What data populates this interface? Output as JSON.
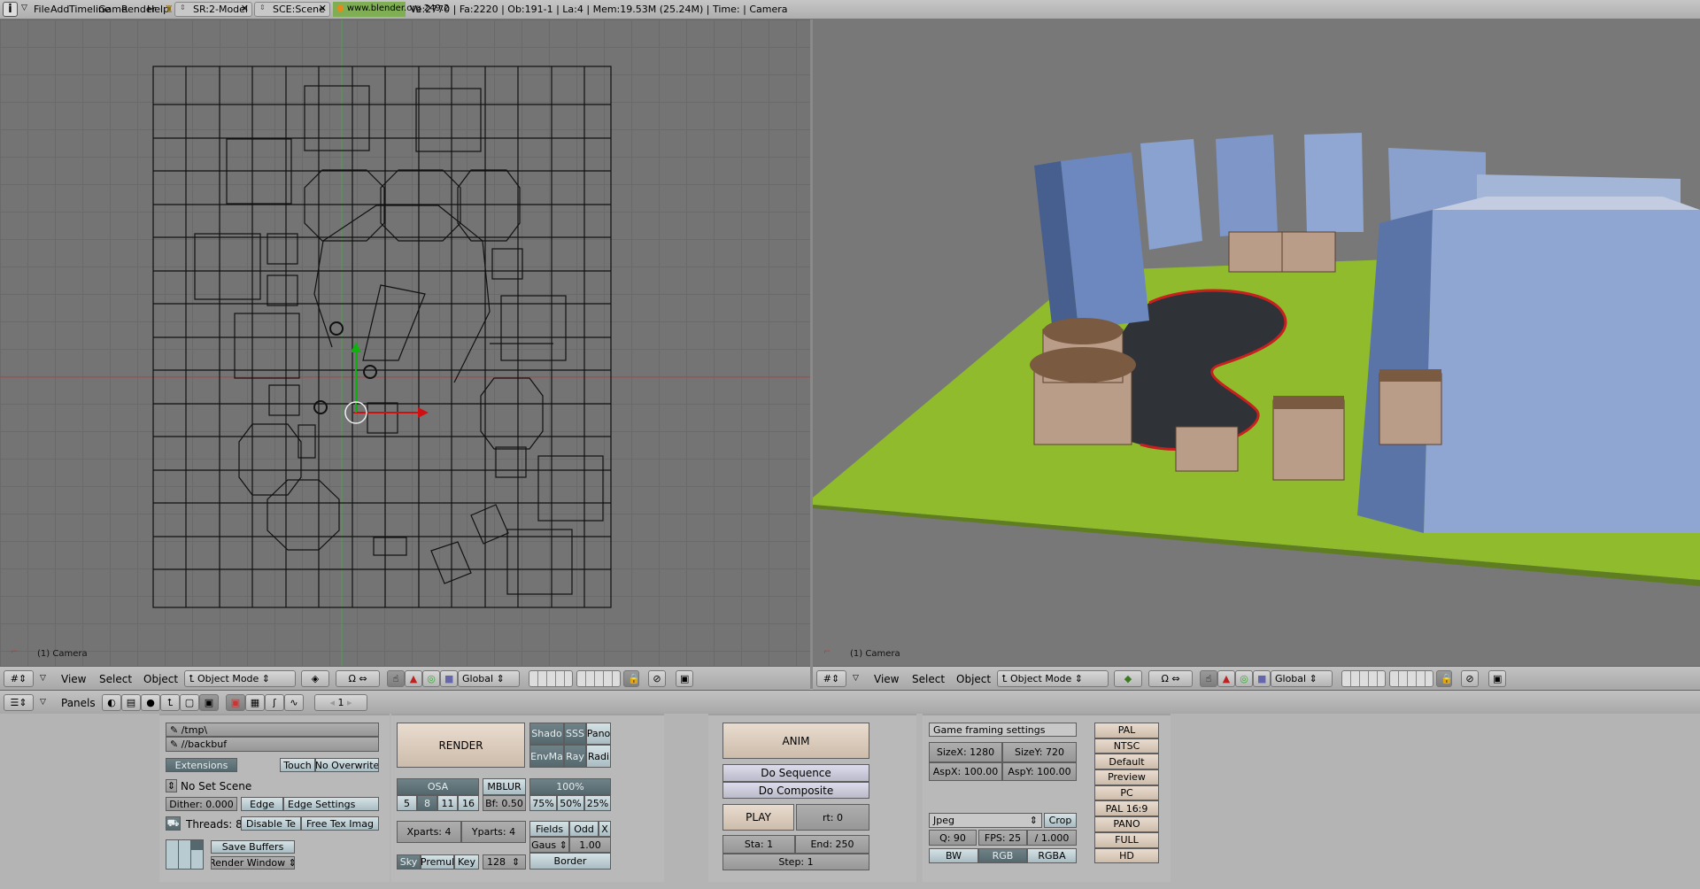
{
  "topbar": {
    "menu": [
      "File",
      "Add",
      "Timeline",
      "Game",
      "Render",
      "Help"
    ],
    "screen": "SR:2-Model",
    "scene": "SCE:Scene",
    "version": "www.blender.org 249.2",
    "stats": "Ve:2770 | Fa:2220 | Ob:191-1 | La:4  | Mem:19.53M (25.24M)  | Time: | Camera"
  },
  "viewports": [
    {
      "label": "(1) Camera"
    },
    {
      "label": "(1) Camera"
    }
  ],
  "vheader": {
    "menus": [
      "View",
      "Select",
      "Object"
    ],
    "mode": "Object Mode",
    "orientation": "Global"
  },
  "buttons_header": {
    "label": "Panels",
    "frame": "1"
  },
  "output": {
    "path1": "/tmp\\",
    "path2": "//backbuf",
    "extensions": "Extensions",
    "touch": "Touch",
    "no_overwrite": "No Overwrite",
    "set_scene": "No Set Scene",
    "dither": "Dither: 0.000",
    "edge": "Edge",
    "edge_settings": "Edge Settings",
    "threads": "Threads: 8",
    "disable_tex": "Disable Te",
    "free_tex": "Free Tex Imag",
    "save_buffers": "Save Buffers",
    "render_window": "Render Window"
  },
  "render": {
    "render": "RENDER",
    "shado": "Shado",
    "sss": "SSS",
    "pano": "Pano",
    "envmap": "EnvMa",
    "ray": "Ray",
    "radi": "Radi",
    "osa": "OSA",
    "osa_levels": [
      "5",
      "8",
      "11",
      "16"
    ],
    "mblur": "MBLUR",
    "bf": "Bf: 0.50",
    "size": "100%",
    "sizes": [
      "75%",
      "50%",
      "25%"
    ],
    "xparts": "Xparts: 4",
    "yparts": "Yparts: 4",
    "fields": "Fields",
    "odd": "Odd",
    "x": "X",
    "filter": "Gaus",
    "filter_size": "1.00",
    "border": "Border",
    "sky": "Sky",
    "premul": "Premul",
    "key": "Key",
    "tile": "128"
  },
  "anim": {
    "anim": "ANIM",
    "do_sequence": "Do Sequence",
    "do_composite": "Do Composite",
    "play": "PLAY",
    "rt": "rt: 0",
    "sta": "Sta: 1",
    "end": "End: 250",
    "step": "Step: 1"
  },
  "format": {
    "game_framing": "Game framing settings",
    "sizex": "SizeX: 1280",
    "sizey": "SizeY: 720",
    "aspx": "AspX: 100.00",
    "aspy": "AspY: 100.00",
    "filetype": "Jpeg",
    "crop": "Crop",
    "quality": "Q: 90",
    "fps": "FPS: 25",
    "fps_base": "/ 1.000",
    "bw": "BW",
    "rgb": "RGB",
    "rgba": "RGBA",
    "presets": [
      "PAL",
      "NTSC",
      "Default",
      "Preview",
      "PC",
      "PAL 16:9",
      "PANO",
      "FULL",
      "HD"
    ]
  }
}
